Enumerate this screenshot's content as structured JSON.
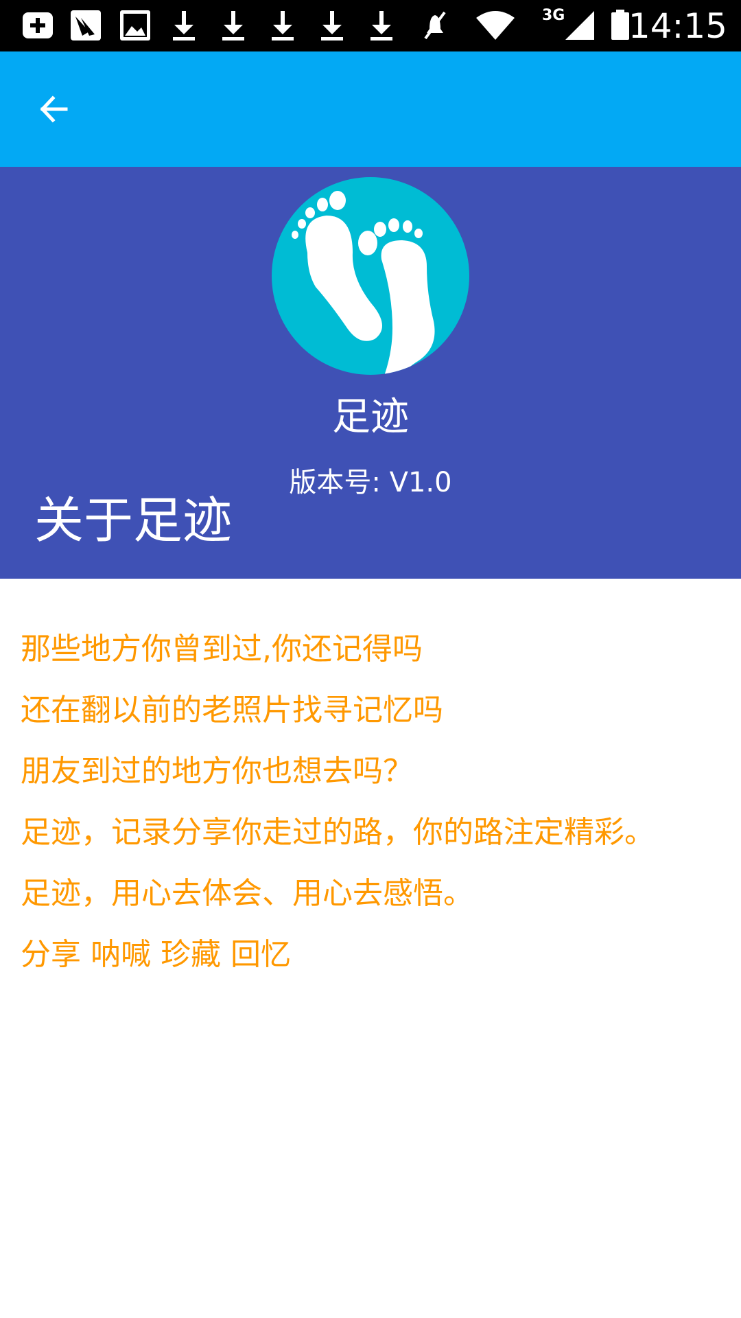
{
  "status_bar": {
    "time": "14:15",
    "network": "3G",
    "icons": [
      "add-icon",
      "bird-icon",
      "image-icon",
      "download-icon",
      "download-icon",
      "download-icon",
      "download-icon",
      "download-icon",
      "mute-icon",
      "wifi-icon",
      "signal-icon",
      "battery-icon"
    ]
  },
  "toolbar": {
    "back_icon": "arrow-back-icon"
  },
  "header": {
    "app_name": "足迹",
    "version": "版本号: V1.0",
    "about_title": "关于足迹"
  },
  "content": {
    "lines": [
      "那些地方你曾到过,你还记得吗",
      "还在翻以前的老照片找寻记忆吗",
      "朋友到过的地方你也想去吗？",
      "足迹，记录分享你走过的路，你的路注定精彩。",
      "足迹，用心去体会、用心去感悟。",
      "分享 呐喊 珍藏 回忆"
    ]
  },
  "colors": {
    "toolbar": "#03a9f4",
    "header": "#3f51b5",
    "logo_bg": "#00bcd4",
    "text_accent": "#ff9800"
  }
}
